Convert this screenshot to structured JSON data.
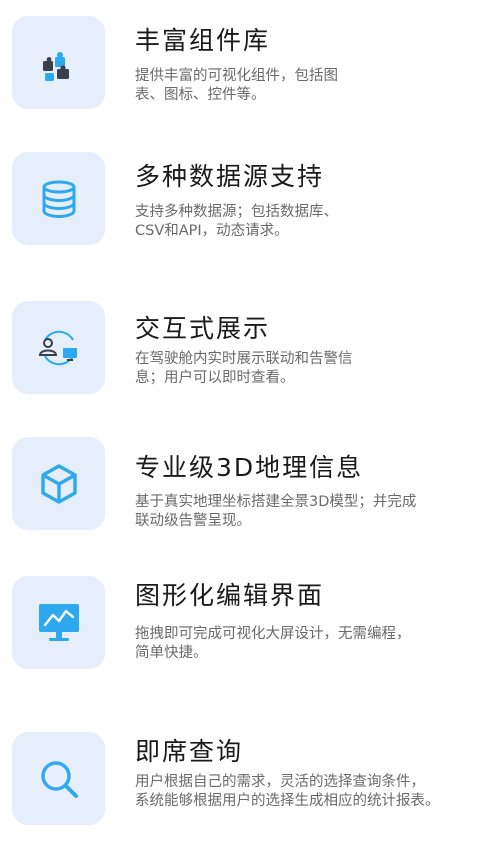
{
  "features": [
    {
      "title": "丰富组件库",
      "description": "提供丰富的可视化组件，包括图\n表、图标、控件等。",
      "icon": "puzzle-icon"
    },
    {
      "title": "多种数据源支持",
      "description": "支持多种数据源；包括数据库、\nCSV和API，动态请求。",
      "icon": "database-icon"
    },
    {
      "title": "交互式展示",
      "description": "在驾驶舱内实时展示联动和告警信\n息；用户可以即时查看。",
      "icon": "user-sync-icon"
    },
    {
      "title": "专业级3D地理信息",
      "description": "基于真实地理坐标搭建全景3D模型；并完成\n联动级告警呈现。",
      "icon": "cube-icon"
    },
    {
      "title": "图形化编辑界面",
      "description": "拖拽即可完成可视化大屏设计，无需编程，\n简单快捷。",
      "icon": "chart-monitor-icon"
    },
    {
      "title": "即席查询",
      "description": "用户根据自己的需求，灵活的选择查询条件，\n系统能够根据用户的选择生成相应的统计报表。",
      "icon": "search-icon"
    }
  ],
  "colors": {
    "icon_tile_bg": "#e6eefb",
    "accent_blue": "#2ea8ee",
    "title_text": "#1a1a1a",
    "description_text": "#6a6a6a"
  }
}
